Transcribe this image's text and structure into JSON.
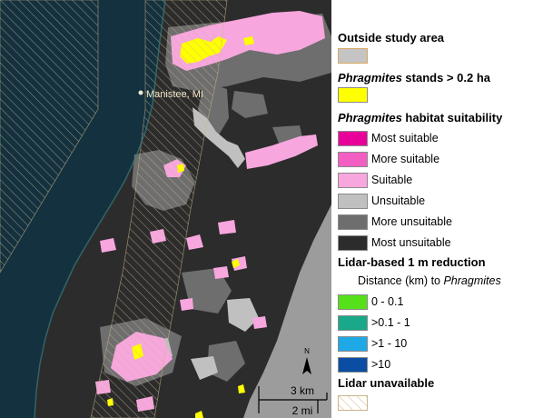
{
  "map": {
    "place_label": "Manistee, MI",
    "scale_km": "3 km",
    "scale_mi": "2 mi",
    "north_label": "N"
  },
  "legend": {
    "outside_study_area": {
      "label": "Outside study area",
      "color": "#c4c4c4",
      "border": "#d8a860"
    },
    "stands": {
      "label_italic": "Phragmites",
      "label_rest": " stands > 0.2 ha",
      "color": "#ffff00"
    },
    "suitability": {
      "heading_italic": "Phragmites",
      "heading_rest": " habitat suitability",
      "classes": [
        {
          "label": "Most suitable",
          "color": "#e8009a"
        },
        {
          "label": "More suitable",
          "color": "#f25ec2"
        },
        {
          "label": "Suitable",
          "color": "#f7a6de"
        },
        {
          "label": "Unsuitable",
          "color": "#c0c0c0"
        },
        {
          "label": "More unsuitable",
          "color": "#6e6e6e"
        },
        {
          "label": "Most unsuitable",
          "color": "#2c2c2c"
        }
      ]
    },
    "lidar_reduction": {
      "heading": "Lidar-based 1 m reduction",
      "distance_prefix": "Distance (km) to ",
      "distance_italic": "Phragmites",
      "classes": [
        {
          "label": "0 - 0.1",
          "color": "#55e01a"
        },
        {
          "label": ">0.1 - 1",
          "color": "#1aa88a"
        },
        {
          "label": ">1 - 10",
          "color": "#1ea9e6"
        },
        {
          "label": ">10",
          "color": "#0a4da3"
        }
      ]
    },
    "lidar_unavailable": {
      "label": "Lidar unavailable",
      "hatch_color": "#c9b58a"
    }
  }
}
